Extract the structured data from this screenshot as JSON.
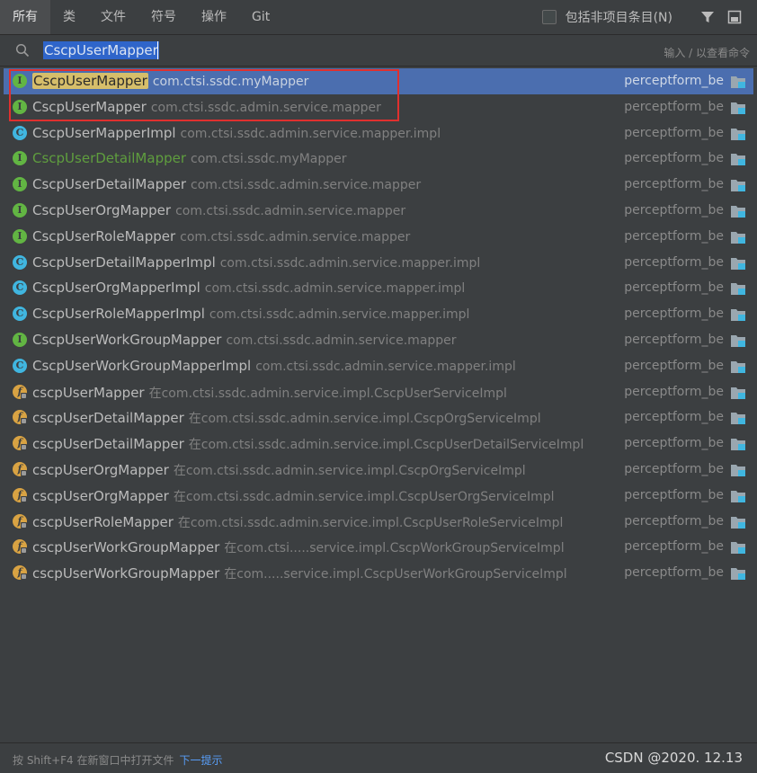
{
  "tabs": [
    "所有",
    "类",
    "文件",
    "符号",
    "操作",
    "Git"
  ],
  "options": {
    "include_non_project": "包括非项目条目(N)"
  },
  "search": {
    "query": "CscpUserMapper",
    "hint": "输入 / 以查看命令"
  },
  "results": [
    {
      "icon": "interface",
      "name": "CscpUserMapper",
      "loc": "com.ctsi.ssdc.myMapper",
      "module": "perceptform_be",
      "selected": true
    },
    {
      "icon": "interface",
      "name": "CscpUserMapper",
      "loc": "com.ctsi.ssdc.admin.service.mapper",
      "module": "perceptform_be"
    },
    {
      "icon": "class",
      "name": "CscpUserMapperImpl",
      "loc": "com.ctsi.ssdc.admin.service.mapper.impl",
      "module": "perceptform_be"
    },
    {
      "icon": "interface",
      "name": "CscpUserDetailMapper",
      "loc": "com.ctsi.ssdc.myMapper",
      "module": "perceptform_be",
      "green": true
    },
    {
      "icon": "interface",
      "name": "CscpUserDetailMapper",
      "loc": "com.ctsi.ssdc.admin.service.mapper",
      "module": "perceptform_be"
    },
    {
      "icon": "interface",
      "name": "CscpUserOrgMapper",
      "loc": "com.ctsi.ssdc.admin.service.mapper",
      "module": "perceptform_be"
    },
    {
      "icon": "interface",
      "name": "CscpUserRoleMapper",
      "loc": "com.ctsi.ssdc.admin.service.mapper",
      "module": "perceptform_be"
    },
    {
      "icon": "class",
      "name": "CscpUserDetailMapperImpl",
      "loc": "com.ctsi.ssdc.admin.service.mapper.impl",
      "module": "perceptform_be"
    },
    {
      "icon": "class",
      "name": "CscpUserOrgMapperImpl",
      "loc": "com.ctsi.ssdc.admin.service.mapper.impl",
      "module": "perceptform_be"
    },
    {
      "icon": "class",
      "name": "CscpUserRoleMapperImpl",
      "loc": "com.ctsi.ssdc.admin.service.mapper.impl",
      "module": "perceptform_be"
    },
    {
      "icon": "interface",
      "name": "CscpUserWorkGroupMapper",
      "loc": "com.ctsi.ssdc.admin.service.mapper",
      "module": "perceptform_be"
    },
    {
      "icon": "class",
      "name": "CscpUserWorkGroupMapperImpl",
      "loc": "com.ctsi.ssdc.admin.service.mapper.impl",
      "module": "perceptform_be"
    },
    {
      "icon": "field",
      "name": "cscpUserMapper",
      "loc": "在com.ctsi.ssdc.admin.service.impl.CscpUserServiceImpl",
      "module": "perceptform_be"
    },
    {
      "icon": "field",
      "name": "cscpUserDetailMapper",
      "loc": "在com.ctsi.ssdc.admin.service.impl.CscpOrgServiceImpl",
      "module": "perceptform_be"
    },
    {
      "icon": "field",
      "name": "cscpUserDetailMapper",
      "loc": "在com.ctsi.ssdc.admin.service.impl.CscpUserDetailServiceImpl",
      "module": "perceptform_be"
    },
    {
      "icon": "field",
      "name": "cscpUserOrgMapper",
      "loc": "在com.ctsi.ssdc.admin.service.impl.CscpOrgServiceImpl",
      "module": "perceptform_be"
    },
    {
      "icon": "field",
      "name": "cscpUserOrgMapper",
      "loc": "在com.ctsi.ssdc.admin.service.impl.CscpUserOrgServiceImpl",
      "module": "perceptform_be"
    },
    {
      "icon": "field",
      "name": "cscpUserRoleMapper",
      "loc": "在com.ctsi.ssdc.admin.service.impl.CscpUserRoleServiceImpl",
      "module": "perceptform_be"
    },
    {
      "icon": "field",
      "name": "cscpUserWorkGroupMapper",
      "loc": "在com.ctsi.....service.impl.CscpWorkGroupServiceImpl",
      "module": "perceptform_be"
    },
    {
      "icon": "field",
      "name": "cscpUserWorkGroupMapper",
      "loc": "在com.....service.impl.CscpUserWorkGroupServiceImpl",
      "module": "perceptform_be"
    }
  ],
  "footer": {
    "text": "按 Shift+F4 在新窗口中打开文件",
    "link": "下一提示",
    "watermark": "CSDN @2020. 12.13"
  },
  "colors": {
    "background": "#3c3f41",
    "selection": "#4b6eaf",
    "highlight_match": "#d6be6a",
    "annotation_box": "#e0302e",
    "interface_icon": "#62b543",
    "class_icon": "#40b6e0",
    "field_icon": "#d9a343",
    "link": "#589df6"
  }
}
